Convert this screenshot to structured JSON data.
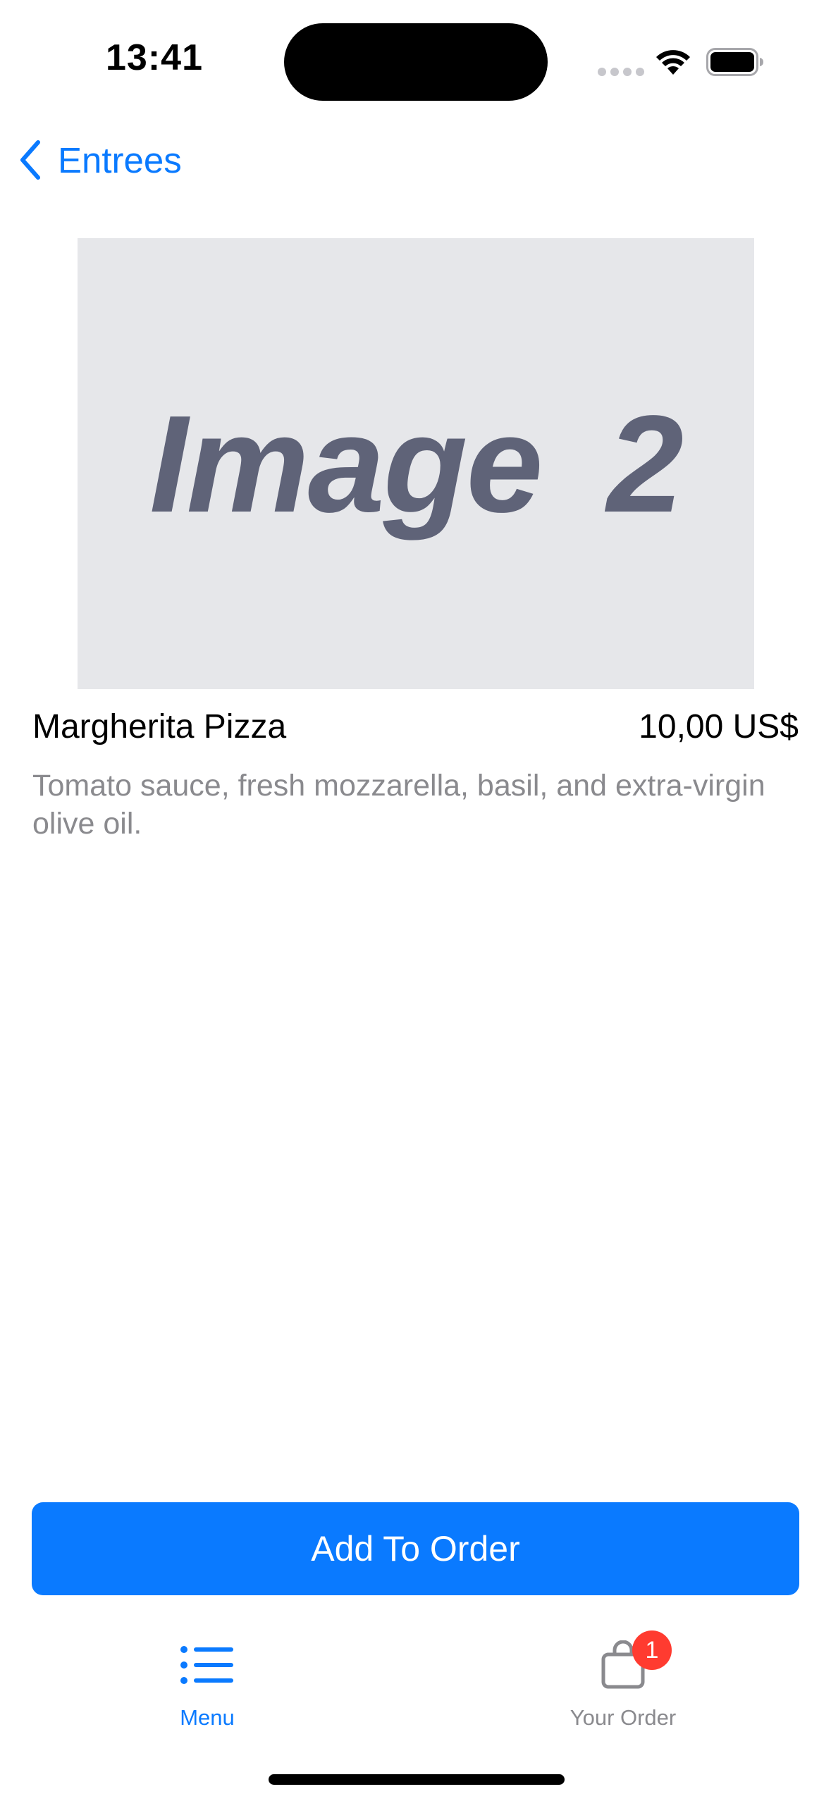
{
  "status_bar": {
    "time": "13:41"
  },
  "nav": {
    "back_label": "Entrees",
    "back_icon": "chevron-left-icon"
  },
  "item": {
    "image_placeholder": "Image  2",
    "name": "Margherita Pizza",
    "price": "10,00 US$",
    "description": "Tomato sauce, fresh mozzarella, basil, and extra-virgin olive oil."
  },
  "actions": {
    "add_to_order_label": "Add To Order"
  },
  "tab_bar": {
    "tabs": [
      {
        "label": "Menu",
        "icon": "list-icon",
        "selected": true
      },
      {
        "label": "Your Order",
        "icon": "bag-icon",
        "selected": false,
        "badge": "1"
      }
    ]
  },
  "colors": {
    "accent": "#0a7aff",
    "badge": "#ff3b30",
    "placeholder_bg": "#e6e7ea",
    "placeholder_text": "#5f6378",
    "secondary_text": "#8a8a8e"
  }
}
